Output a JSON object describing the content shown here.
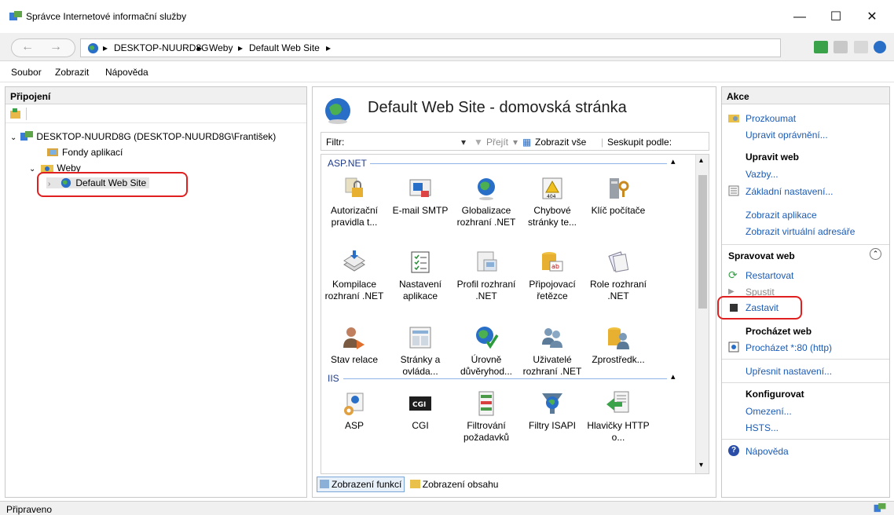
{
  "window": {
    "title": "Správce Internetové informační služby",
    "minimize": "—",
    "maximize": "☐",
    "close": "✕"
  },
  "address": {
    "crumbs": [
      "DESKTOP-NUURD8G",
      "Weby",
      "Default Web Site"
    ],
    "separator": "▸"
  },
  "menu": [
    "Soubor",
    "Zobrazit",
    "Nápověda"
  ],
  "connections": {
    "header": "Připojení",
    "tree": {
      "server": "DESKTOP-NUURD8G (DESKTOP-NUURD8G\\František)",
      "app_pools": "Fondy aplikací",
      "sites": "Weby",
      "site": "Default Web Site"
    }
  },
  "center": {
    "title": "Default Web Site - domovská stránka",
    "filter": {
      "label": "Filtr:",
      "go": "Přejít",
      "show_all": "Zobrazit vše",
      "group_by": "Seskupit podle:"
    },
    "groups": {
      "aspnet": "ASP.NET",
      "iis": "IIS"
    },
    "features_aspnet_row1": [
      "Autorizační pravidla t...",
      "E-mail SMTP",
      "Globalizace rozhraní .NET",
      "Chybové stránky te...",
      "Klíč počítače"
    ],
    "features_aspnet_row2": [
      "Kompilace rozhraní .NET",
      "Nastavení aplikace",
      "Profil rozhraní .NET",
      "Připojovací řetězce",
      "Role rozhraní .NET"
    ],
    "features_aspnet_row3": [
      "Stav relace",
      "Stránky a ovláda...",
      "Úrovně důvěryhod...",
      "Uživatelé rozhraní .NET",
      "Zprostředk..."
    ],
    "features_iis_row1": [
      "ASP",
      "CGI",
      "Filtrování požadavků",
      "Filtry ISAPI",
      "Hlavičky HTTP o..."
    ],
    "tabs": {
      "features": "Zobrazení funkcí",
      "content": "Zobrazení obsahu"
    }
  },
  "actions": {
    "header": "Akce",
    "explore": "Prozkoumat",
    "edit_perms": "Upravit oprávnění...",
    "edit_site_head": "Upravit web",
    "bindings": "Vazby...",
    "basic_settings": "Základní nastavení...",
    "view_apps": "Zobrazit aplikace",
    "view_vdirs": "Zobrazit virtuální adresáře",
    "manage_head": "Spravovat web",
    "restart": "Restartovat",
    "start": "Spustit",
    "stop": "Zastavit",
    "browse_head": "Procházet web",
    "browse": "Procházet *:80 (http)",
    "advanced": "Upřesnit nastavení...",
    "configure_head": "Konfigurovat",
    "limits": "Omezení...",
    "hsts": "HSTS...",
    "help": "Nápověda"
  },
  "status": "Připraveno",
  "colors": {
    "link": "#1a5bb5",
    "annotation": "#e02020",
    "group_line": "#8fb4e8"
  }
}
